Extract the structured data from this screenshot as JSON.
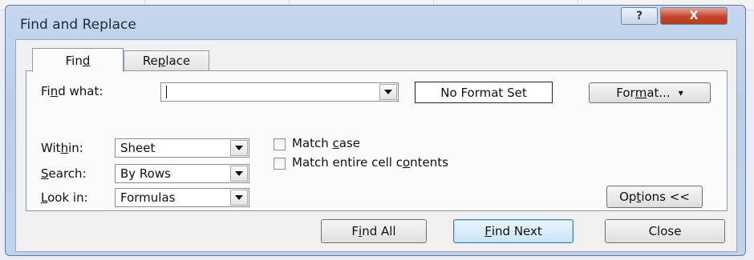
{
  "dialog": {
    "title": "Find and Replace",
    "help_glyph": "?",
    "close_glyph": "X"
  },
  "tabs": {
    "find": {
      "pre": "Fin",
      "key": "d",
      "post": ""
    },
    "replace": {
      "pre": "Re",
      "key": "p",
      "post": "lace"
    }
  },
  "find_what": {
    "label": {
      "pre": "Fi",
      "key": "n",
      "post": "d what:"
    },
    "value": ""
  },
  "format_status": "No Format Set",
  "format_button": {
    "pre": "For",
    "key": "m",
    "post": "at...",
    "arrow": "▾"
  },
  "within": {
    "label": {
      "pre": "Wit",
      "key": "h",
      "post": "in:"
    },
    "value": "Sheet"
  },
  "search": {
    "label": {
      "pre": "",
      "key": "S",
      "post": "earch:"
    },
    "value": "By Rows"
  },
  "look_in": {
    "label": {
      "pre": "",
      "key": "L",
      "post": "ook in:"
    },
    "value": "Formulas"
  },
  "match_case": {
    "label": {
      "pre": "Match ",
      "key": "c",
      "post": "ase"
    },
    "checked": false
  },
  "match_entire": {
    "label": {
      "pre": "Match entire cell c",
      "key": "o",
      "post": "ntents"
    },
    "checked": false
  },
  "options_button": {
    "pre": "Op",
    "key": "t",
    "post": "ions <<"
  },
  "find_all_button": {
    "pre": "F",
    "key": "i",
    "post": "nd All"
  },
  "find_next_button": {
    "pre": "",
    "key": "F",
    "post": "ind Next"
  },
  "close_button": "Close"
}
